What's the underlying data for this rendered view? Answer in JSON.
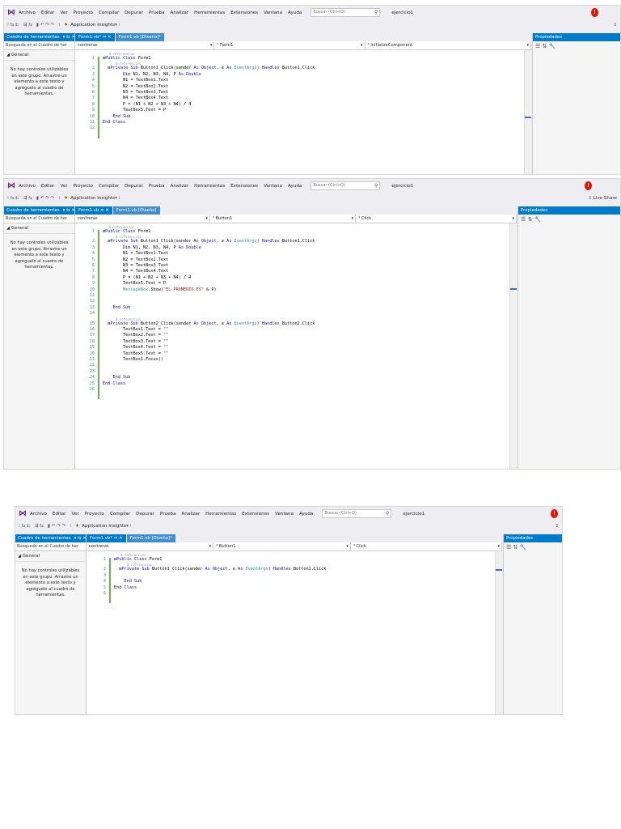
{
  "menu": {
    "items": [
      "Archivo",
      "Editar",
      "Ver",
      "Proyecto",
      "Compilar",
      "Depurar",
      "Prueba",
      "Analizar",
      "Herramientas",
      "Extensiones",
      "Ventana",
      "Ayuda"
    ],
    "search_placeholder": "Buscar (Ctrl+Q)",
    "project": "ejercicio1",
    "notification": "!"
  },
  "toolbar": {
    "insights": "Application Insights",
    "live_share": "Live Share"
  },
  "toolbox": {
    "title": "Cuadro de herramientas",
    "pin": "▾ ⇆ ✕",
    "search_placeholder": "Búsqueda en el Cuadro de her",
    "general": "◢ General",
    "empty_message": "No hay controles utilizables en este grupo. Arrastre un elemento a este texto y agréguelo al cuadro de herramientas."
  },
  "properties": {
    "title": "Propiedades",
    "tools": "☰ ⇅ 🔧"
  },
  "screens": [
    {
      "tabs": [
        "Form1.vb* ⇔ ✕",
        "Form1.vb [Diseño]*"
      ],
      "nav": [
        "contreras",
        "⁴ Form1",
        "⁴ InitializeComponent"
      ],
      "lines": [
        {
          "n": "1",
          "ref": "0 referencias",
          "t": "⊟Public Class Form1"
        },
        {
          "n": "2",
          "ref": "0 referencias",
          "t": "  ⊟Private Sub Button1_Click(sender As Object, e As EventArgs) Handles Button1.Click"
        },
        {
          "n": "3",
          "t": "        Dim N1, N2, N3, N4, P As Double"
        },
        {
          "n": "4",
          "t": "        N1 = TextBox1.Text"
        },
        {
          "n": "5",
          "t": "        N2 = TextBox2.Text"
        },
        {
          "n": "6",
          "t": "        N3 = TextBox3.Text"
        },
        {
          "n": "7",
          "t": "        N4 = TextBox4.Text"
        },
        {
          "n": "8",
          "t": "        P = (N1 + N2 + N3 + N4) / 4"
        },
        {
          "n": "9",
          "t": "        TextBox5.Text = P"
        },
        {
          "n": "10",
          "t": "    End Sub"
        },
        {
          "n": "11",
          "t": "End Class"
        },
        {
          "n": "12",
          "t": ""
        }
      ]
    },
    {
      "tabs": [
        "Form1.vb ⇔ ✕",
        "Form1.vb [Diseño]"
      ],
      "nav": [
        "contreras",
        "⁴ Button1",
        "⁴ Click"
      ],
      "lines": [
        {
          "n": "1",
          "ref": "0 referencias",
          "t": "⊟Public Class Form1"
        },
        {
          "n": "2",
          "ref": "0 referencias",
          "t": "  ⊟Private Sub Button1_Click(sender As Object, e As EventArgs) Handles Button1.Click"
        },
        {
          "n": "3",
          "t": "        Dim N1, N2, N3, N4, P As Double"
        },
        {
          "n": "4",
          "t": "        N1 = TextBox1.Text"
        },
        {
          "n": "5",
          "t": "        N2 = TextBox2.Text"
        },
        {
          "n": "6",
          "t": "        N3 = TextBox3.Text"
        },
        {
          "n": "7",
          "t": "        N4 = TextBox4.Text"
        },
        {
          "n": "8",
          "t": "        P = (N1 + N2 + N3 + N4) / 4"
        },
        {
          "n": "9",
          "t": "        TextBox5.Text = P"
        },
        {
          "n": "10",
          "t": "        MessageBox.Show(\"EL PROMEDIO ES\" & P)"
        },
        {
          "n": "11",
          "t": ""
        },
        {
          "n": "12",
          "t": ""
        },
        {
          "n": "13",
          "t": "    End Sub"
        },
        {
          "n": "14",
          "t": ""
        },
        {
          "n": "15",
          "ref": "0 referencias",
          "t": "  ⊟Private Sub Button2_Click(sender As Object, e As EventArgs) Handles Button2.Click"
        },
        {
          "n": "16",
          "t": "        TextBox1.Text = \"\""
        },
        {
          "n": "17",
          "t": "        TextBox2.Text = \"\""
        },
        {
          "n": "18",
          "t": "        TextBox3.Text = \"\""
        },
        {
          "n": "19",
          "t": "        TextBox4.Text = \"\""
        },
        {
          "n": "20",
          "t": "        TextBox5.Text = \"\""
        },
        {
          "n": "21",
          "t": "        TextBox1.Focus()"
        },
        {
          "n": "22",
          "t": ""
        },
        {
          "n": "23",
          "t": ""
        },
        {
          "n": "24",
          "t": "    End Sub"
        },
        {
          "n": "25",
          "t": "End Class"
        },
        {
          "n": "26",
          "t": ""
        }
      ]
    },
    {
      "tabs": [
        "Form1.vb* ⇔ ✕",
        "Form1.vb [Diseño]*"
      ],
      "nav": [
        "contreras",
        "⁴ Button1",
        "⁴ Click"
      ],
      "lines": [
        {
          "n": "1",
          "ref": "0 referencias",
          "t": "⊟Public Class Form1"
        },
        {
          "n": "2",
          "ref": "0 referencias",
          "t": "  ⊟Private Sub Button1_Click(sender As Object, e As EventArgs) Handles Button1.Click"
        },
        {
          "n": "3",
          "t": ""
        },
        {
          "n": "4",
          "t": "    End Sub"
        },
        {
          "n": "5",
          "t": "End Class"
        },
        {
          "n": "6",
          "t": ""
        }
      ]
    }
  ]
}
